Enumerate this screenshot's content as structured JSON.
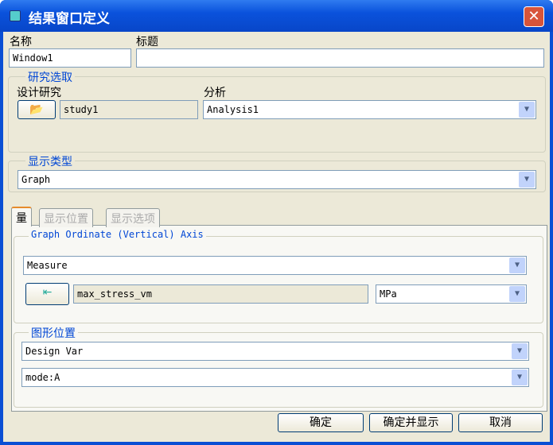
{
  "title": "结果窗口定义",
  "name_label": "名称",
  "name_value": "Window1",
  "caption_label": "标题",
  "caption_value": "",
  "study_group": "研究选取",
  "design_study_label": "设计研究",
  "study_value": "study1",
  "analysis_label": "分析",
  "analysis_value": "Analysis1",
  "display_type_group": "显示类型",
  "display_type_value": "Graph",
  "tabs": [
    "量",
    "显示位置",
    "显示选项"
  ],
  "ordinate_group": "Graph Ordinate (Vertical) Axis",
  "measure_value": "Measure",
  "measure_name": "max_stress_vm",
  "unit_value": "MPa",
  "graph_position_group": "图形位置",
  "position_value": "Design Var",
  "mode_value": "mode:A",
  "buttons": {
    "ok": "确定",
    "ok_show": "确定并显示",
    "cancel": "取消"
  }
}
